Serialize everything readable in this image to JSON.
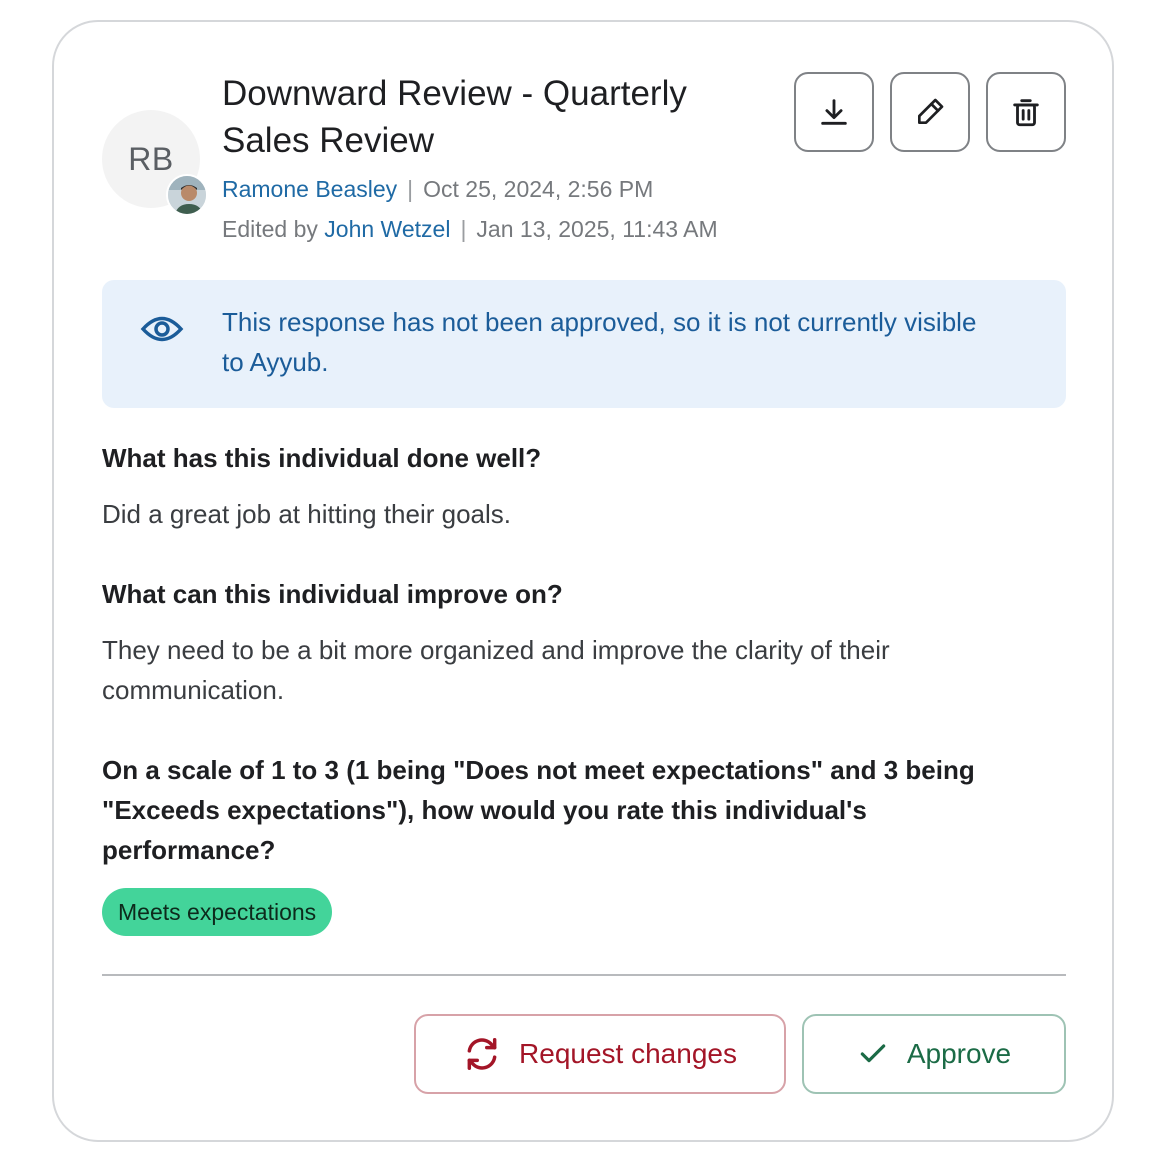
{
  "review": {
    "title": "Downward Review - Quarterly Sales Review",
    "avatar_initials": "RB",
    "author": "Ramone Beasley",
    "created_at": "Oct 25, 2024, 2:56 PM",
    "edited_prefix": "Edited by",
    "editor": "John Wetzel",
    "edited_at": "Jan 13, 2025, 11:43 AM",
    "separator": "|"
  },
  "toolbar": {
    "download_icon": "download-icon",
    "edit_icon": "pencil-icon",
    "delete_icon": "trash-icon"
  },
  "banner": {
    "icon": "eye-icon",
    "text": "This response has not been approved, so it is not currently visible to Ayyub."
  },
  "questions": [
    {
      "question": "What has this individual done well?",
      "answer": "Did a great job at hitting their goals."
    },
    {
      "question": "What can this individual improve on?",
      "answer": "They need to be a bit more organized and improve the clarity of their communication."
    },
    {
      "question": "On a scale of 1 to 3 (1 being \"Does not meet expectations\" and 3 being \"Exceeds expectations\"), how would you rate this individual's performance?",
      "answer": "Meets expectations"
    }
  ],
  "actions": {
    "request_changes_label": "Request changes",
    "approve_label": "Approve"
  },
  "colors": {
    "link": "#1f6aa5",
    "banner_bg": "#e8f1fb",
    "banner_text": "#1b5c99",
    "badge_bg": "#43d49a",
    "request_changes": "#a31527",
    "approve": "#1b6b46"
  }
}
